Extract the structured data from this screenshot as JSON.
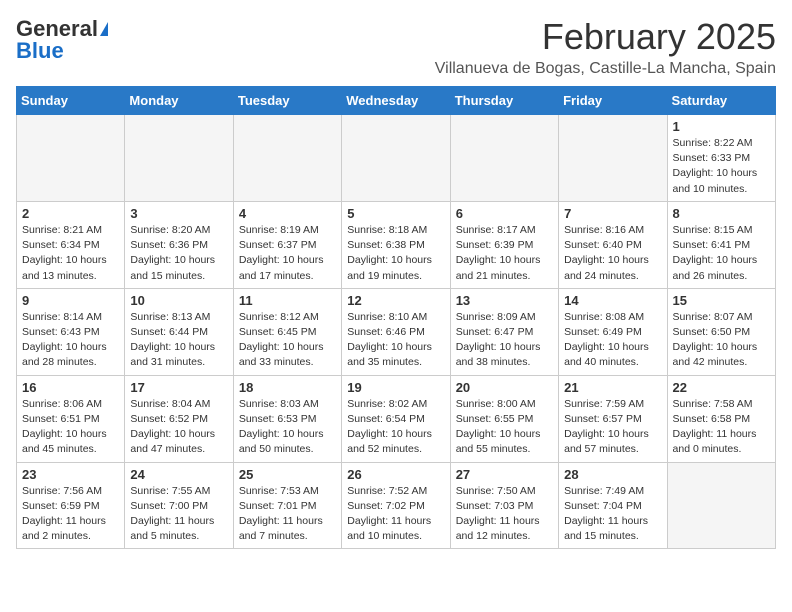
{
  "header": {
    "logo_general": "General",
    "logo_blue": "Blue",
    "month_title": "February 2025",
    "location": "Villanueva de Bogas, Castille-La Mancha, Spain"
  },
  "weekdays": [
    "Sunday",
    "Monday",
    "Tuesday",
    "Wednesday",
    "Thursday",
    "Friday",
    "Saturday"
  ],
  "weeks": [
    [
      {
        "day": "",
        "sunrise": "",
        "sunset": "",
        "daylight": "",
        "empty": true
      },
      {
        "day": "",
        "sunrise": "",
        "sunset": "",
        "daylight": "",
        "empty": true
      },
      {
        "day": "",
        "sunrise": "",
        "sunset": "",
        "daylight": "",
        "empty": true
      },
      {
        "day": "",
        "sunrise": "",
        "sunset": "",
        "daylight": "",
        "empty": true
      },
      {
        "day": "",
        "sunrise": "",
        "sunset": "",
        "daylight": "",
        "empty": true
      },
      {
        "day": "",
        "sunrise": "",
        "sunset": "",
        "daylight": "",
        "empty": true
      },
      {
        "day": "1",
        "sunrise": "Sunrise: 8:22 AM",
        "sunset": "Sunset: 6:33 PM",
        "daylight": "Daylight: 10 hours and 10 minutes.",
        "empty": false
      }
    ],
    [
      {
        "day": "2",
        "sunrise": "Sunrise: 8:21 AM",
        "sunset": "Sunset: 6:34 PM",
        "daylight": "Daylight: 10 hours and 13 minutes.",
        "empty": false
      },
      {
        "day": "3",
        "sunrise": "Sunrise: 8:20 AM",
        "sunset": "Sunset: 6:36 PM",
        "daylight": "Daylight: 10 hours and 15 minutes.",
        "empty": false
      },
      {
        "day": "4",
        "sunrise": "Sunrise: 8:19 AM",
        "sunset": "Sunset: 6:37 PM",
        "daylight": "Daylight: 10 hours and 17 minutes.",
        "empty": false
      },
      {
        "day": "5",
        "sunrise": "Sunrise: 8:18 AM",
        "sunset": "Sunset: 6:38 PM",
        "daylight": "Daylight: 10 hours and 19 minutes.",
        "empty": false
      },
      {
        "day": "6",
        "sunrise": "Sunrise: 8:17 AM",
        "sunset": "Sunset: 6:39 PM",
        "daylight": "Daylight: 10 hours and 21 minutes.",
        "empty": false
      },
      {
        "day": "7",
        "sunrise": "Sunrise: 8:16 AM",
        "sunset": "Sunset: 6:40 PM",
        "daylight": "Daylight: 10 hours and 24 minutes.",
        "empty": false
      },
      {
        "day": "8",
        "sunrise": "Sunrise: 8:15 AM",
        "sunset": "Sunset: 6:41 PM",
        "daylight": "Daylight: 10 hours and 26 minutes.",
        "empty": false
      }
    ],
    [
      {
        "day": "9",
        "sunrise": "Sunrise: 8:14 AM",
        "sunset": "Sunset: 6:43 PM",
        "daylight": "Daylight: 10 hours and 28 minutes.",
        "empty": false
      },
      {
        "day": "10",
        "sunrise": "Sunrise: 8:13 AM",
        "sunset": "Sunset: 6:44 PM",
        "daylight": "Daylight: 10 hours and 31 minutes.",
        "empty": false
      },
      {
        "day": "11",
        "sunrise": "Sunrise: 8:12 AM",
        "sunset": "Sunset: 6:45 PM",
        "daylight": "Daylight: 10 hours and 33 minutes.",
        "empty": false
      },
      {
        "day": "12",
        "sunrise": "Sunrise: 8:10 AM",
        "sunset": "Sunset: 6:46 PM",
        "daylight": "Daylight: 10 hours and 35 minutes.",
        "empty": false
      },
      {
        "day": "13",
        "sunrise": "Sunrise: 8:09 AM",
        "sunset": "Sunset: 6:47 PM",
        "daylight": "Daylight: 10 hours and 38 minutes.",
        "empty": false
      },
      {
        "day": "14",
        "sunrise": "Sunrise: 8:08 AM",
        "sunset": "Sunset: 6:49 PM",
        "daylight": "Daylight: 10 hours and 40 minutes.",
        "empty": false
      },
      {
        "day": "15",
        "sunrise": "Sunrise: 8:07 AM",
        "sunset": "Sunset: 6:50 PM",
        "daylight": "Daylight: 10 hours and 42 minutes.",
        "empty": false
      }
    ],
    [
      {
        "day": "16",
        "sunrise": "Sunrise: 8:06 AM",
        "sunset": "Sunset: 6:51 PM",
        "daylight": "Daylight: 10 hours and 45 minutes.",
        "empty": false
      },
      {
        "day": "17",
        "sunrise": "Sunrise: 8:04 AM",
        "sunset": "Sunset: 6:52 PM",
        "daylight": "Daylight: 10 hours and 47 minutes.",
        "empty": false
      },
      {
        "day": "18",
        "sunrise": "Sunrise: 8:03 AM",
        "sunset": "Sunset: 6:53 PM",
        "daylight": "Daylight: 10 hours and 50 minutes.",
        "empty": false
      },
      {
        "day": "19",
        "sunrise": "Sunrise: 8:02 AM",
        "sunset": "Sunset: 6:54 PM",
        "daylight": "Daylight: 10 hours and 52 minutes.",
        "empty": false
      },
      {
        "day": "20",
        "sunrise": "Sunrise: 8:00 AM",
        "sunset": "Sunset: 6:55 PM",
        "daylight": "Daylight: 10 hours and 55 minutes.",
        "empty": false
      },
      {
        "day": "21",
        "sunrise": "Sunrise: 7:59 AM",
        "sunset": "Sunset: 6:57 PM",
        "daylight": "Daylight: 10 hours and 57 minutes.",
        "empty": false
      },
      {
        "day": "22",
        "sunrise": "Sunrise: 7:58 AM",
        "sunset": "Sunset: 6:58 PM",
        "daylight": "Daylight: 11 hours and 0 minutes.",
        "empty": false
      }
    ],
    [
      {
        "day": "23",
        "sunrise": "Sunrise: 7:56 AM",
        "sunset": "Sunset: 6:59 PM",
        "daylight": "Daylight: 11 hours and 2 minutes.",
        "empty": false
      },
      {
        "day": "24",
        "sunrise": "Sunrise: 7:55 AM",
        "sunset": "Sunset: 7:00 PM",
        "daylight": "Daylight: 11 hours and 5 minutes.",
        "empty": false
      },
      {
        "day": "25",
        "sunrise": "Sunrise: 7:53 AM",
        "sunset": "Sunset: 7:01 PM",
        "daylight": "Daylight: 11 hours and 7 minutes.",
        "empty": false
      },
      {
        "day": "26",
        "sunrise": "Sunrise: 7:52 AM",
        "sunset": "Sunset: 7:02 PM",
        "daylight": "Daylight: 11 hours and 10 minutes.",
        "empty": false
      },
      {
        "day": "27",
        "sunrise": "Sunrise: 7:50 AM",
        "sunset": "Sunset: 7:03 PM",
        "daylight": "Daylight: 11 hours and 12 minutes.",
        "empty": false
      },
      {
        "day": "28",
        "sunrise": "Sunrise: 7:49 AM",
        "sunset": "Sunset: 7:04 PM",
        "daylight": "Daylight: 11 hours and 15 minutes.",
        "empty": false
      },
      {
        "day": "",
        "sunrise": "",
        "sunset": "",
        "daylight": "",
        "empty": true
      }
    ]
  ]
}
